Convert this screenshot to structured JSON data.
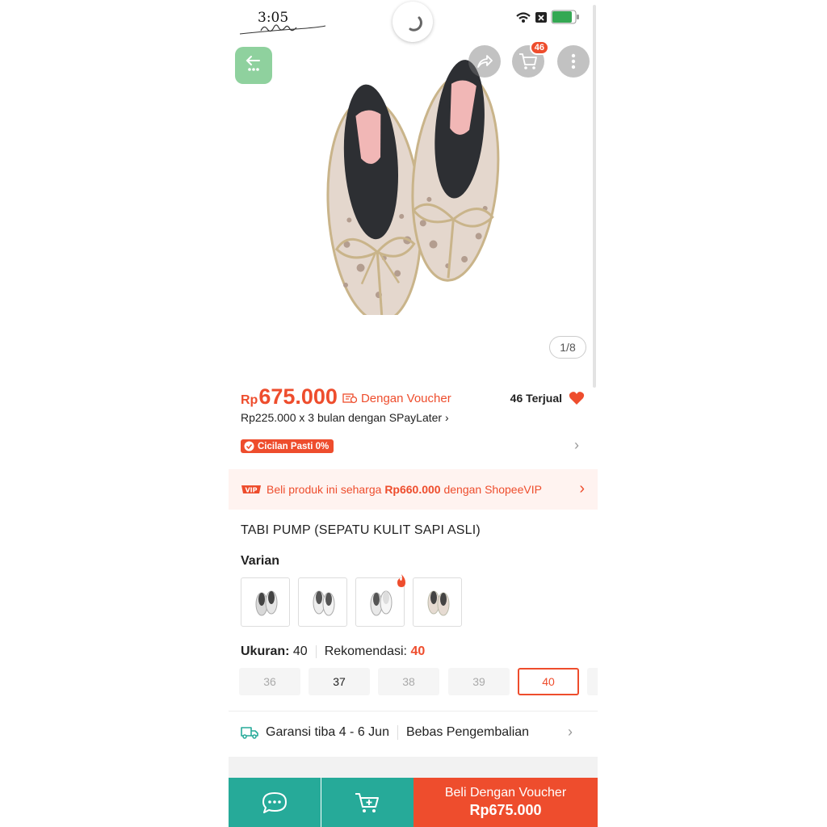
{
  "status_bar": {
    "time": "3:05",
    "logo_script": "Seilun"
  },
  "gallery": {
    "counter": "1/8",
    "cart_count": "46"
  },
  "price": {
    "currency": "Rp",
    "amount": "675.000",
    "voucher_label": "Dengan Voucher",
    "sold": "46 Terjual",
    "installment": "Rp225.000 x 3 bulan dengan SPayLater",
    "cicilan_badge": "Cicilan Pasti 0%"
  },
  "vip": {
    "prefix": "Beli produk ini seharga",
    "price": "Rp660.000",
    "suffix": "dengan ShopeeVIP"
  },
  "product": {
    "title": "TABI PUMP (SEPATU KULIT SAPI ASLI)"
  },
  "variants": {
    "label": "Varian"
  },
  "size": {
    "label": "Ukuran:",
    "value": "40",
    "rec_label": "Rekomendasi:",
    "rec_value": "40",
    "options": [
      "36",
      "37",
      "38",
      "39",
      "40"
    ]
  },
  "shipping": {
    "guarantee": "Garansi tiba 4 - 6 Jun",
    "returns": "Bebas Pengembalian"
  },
  "bottom_bar": {
    "buy_line1": "Beli Dengan Voucher",
    "buy_line2": "Rp675.000"
  },
  "colors": {
    "accent": "#ee4d2d",
    "teal": "#26aa99"
  }
}
